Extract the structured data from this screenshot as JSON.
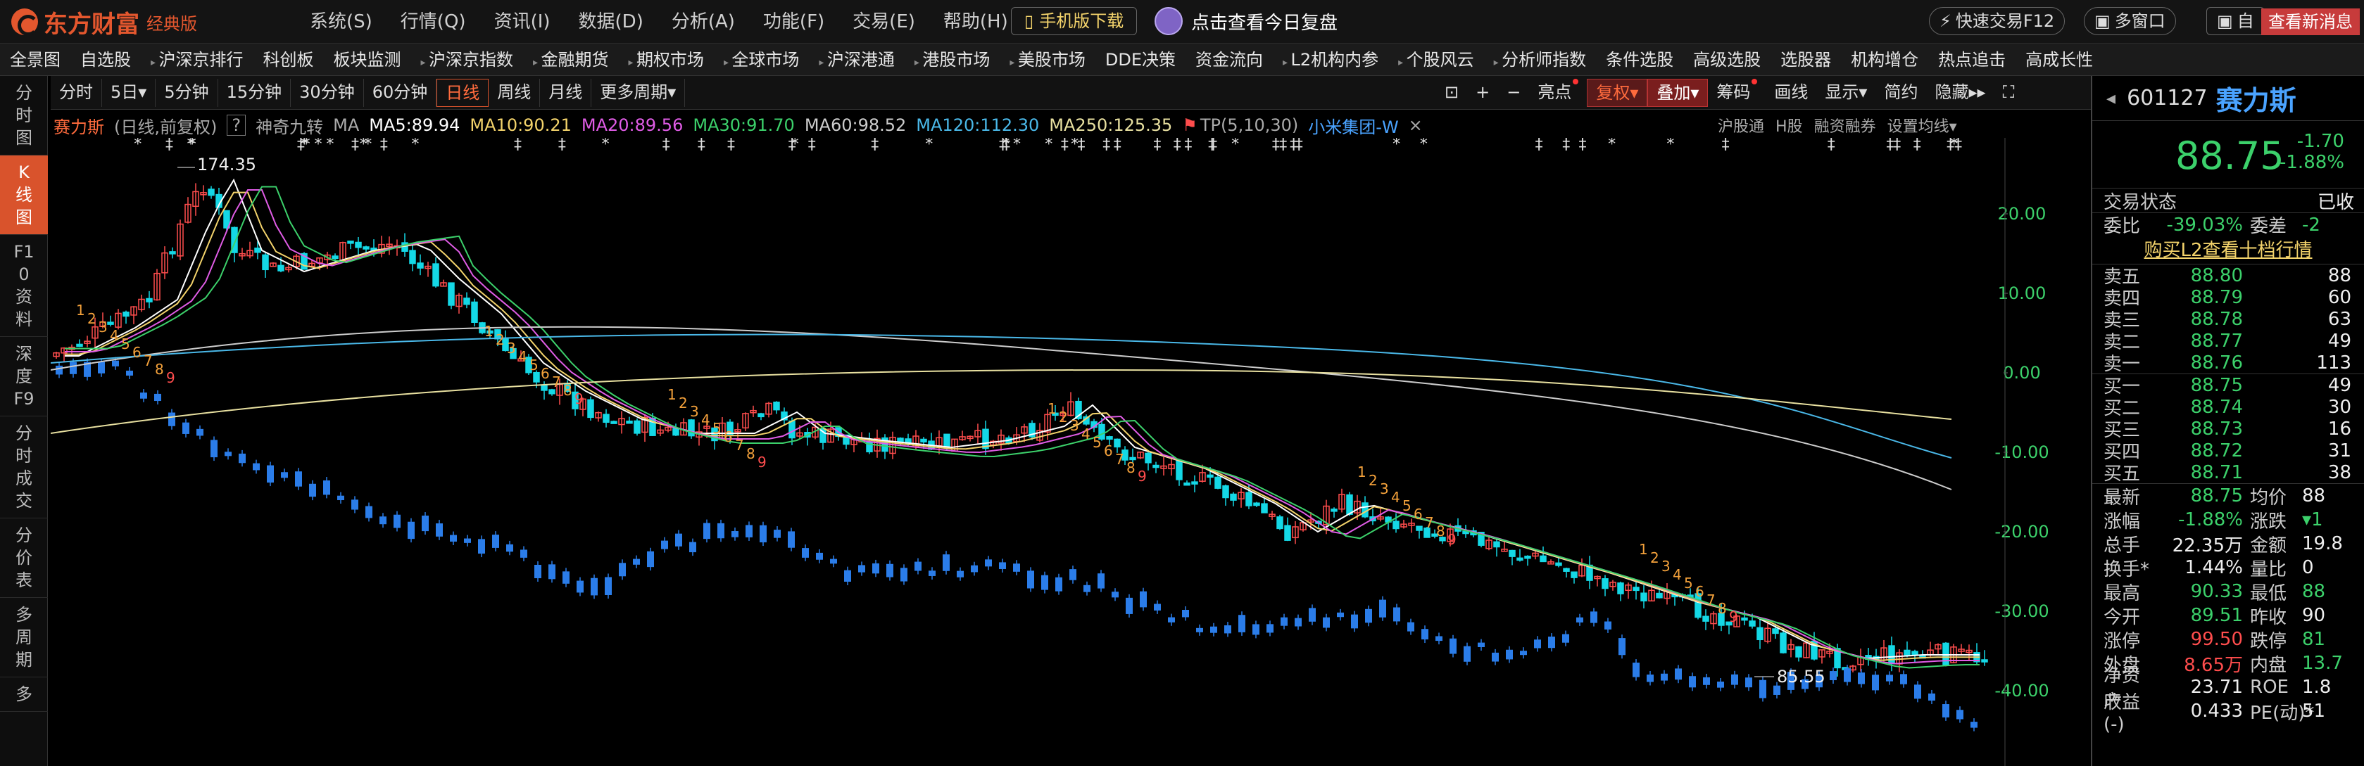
{
  "app": {
    "brand": "东方财富",
    "edition": "经典版",
    "menu": [
      "系统(S)",
      "行情(Q)",
      "资讯(I)",
      "数据(D)",
      "分析(A)",
      "功能(F)",
      "交易(E)",
      "帮助(H)"
    ],
    "mobile_download": "手机版下载",
    "daily_review": "点击查看今日复盘",
    "quick_trade": "快速交易F12",
    "multi_window": "多窗口",
    "cut": "自",
    "news": "查看新消息"
  },
  "nav": [
    "全景图",
    "自选股",
    "沪深京排行",
    "科创板",
    "板块监测",
    "沪深京指数",
    "金融期货",
    "期权市场",
    "全球市场",
    "沪深港通",
    "港股市场",
    "美股市场",
    "DDE决策",
    "资金流向",
    "L2机构内参",
    "个股风云",
    "分析师指数",
    "条件选股",
    "高级选股",
    "选股器",
    "机构增仓",
    "热点追击",
    "高成长性"
  ],
  "left_tabs": [
    {
      "label": "分时图",
      "active": false
    },
    {
      "label": "K线图",
      "active": true
    },
    {
      "label": "F10资料",
      "active": false
    },
    {
      "label": "深度F9",
      "active": false
    },
    {
      "label": "分时成交",
      "active": false
    },
    {
      "label": "分价表",
      "active": false
    },
    {
      "label": "多周期",
      "active": false
    },
    {
      "label": "多",
      "active": false
    }
  ],
  "periods": [
    {
      "label": "分时",
      "active": false
    },
    {
      "label": "5日▾",
      "active": false
    },
    {
      "label": "5分钟",
      "active": false
    },
    {
      "label": "15分钟",
      "active": false
    },
    {
      "label": "30分钟",
      "active": false
    },
    {
      "label": "60分钟",
      "active": false
    },
    {
      "label": "日线",
      "active": true
    },
    {
      "label": "周线",
      "active": false
    },
    {
      "label": "月线",
      "active": false
    },
    {
      "label": "更多周期▾",
      "active": false
    }
  ],
  "tools": {
    "plus": "+",
    "minus": "−",
    "highlight": "亮点",
    "adjust": "复权▾",
    "overlay": "叠加▾",
    "chips": "筹码",
    "draw": "画线",
    "display": "显示▾",
    "simple": "简约",
    "hide": "隐藏▸▸"
  },
  "legend": {
    "stock": "赛力斯",
    "mode": "(日线,前复权)",
    "q": "?",
    "magic": "神奇九转",
    "ma": "MA",
    "ma5": "MA5:89.94",
    "ma10": "MA10:90.21",
    "ma20": "MA20:89.56",
    "ma30": "MA30:91.70",
    "ma60": "MA60:98.52",
    "ma120": "MA120:112.30",
    "ma250": "MA250:125.35",
    "tp": "TP(5,10,30)",
    "compare": "小米集团-W",
    "close_x": "×",
    "right": [
      "沪股通",
      "H股",
      "融资融券",
      "设置均线▾"
    ]
  },
  "colors": {
    "ma5": "#ffffff",
    "ma10": "#f3d36b",
    "ma20": "#e05ce6",
    "ma30": "#3cd16b",
    "ma60": "#cccccc",
    "ma120": "#4ab8e8",
    "ma250": "#e8e0a0",
    "up": "#ff4d4d",
    "down": "#14d8e6",
    "compare": "#2b7de9"
  },
  "chart_data": {
    "type": "candlestick",
    "y_ticks": [
      "20.00",
      "10.00",
      "0.00",
      "-10.00",
      "-20.00",
      "-30.00",
      "-40.00"
    ],
    "high_label": "174.35",
    "low_label": "85.55"
  },
  "quote": {
    "code": "601127",
    "name": "赛力斯",
    "price": "88.75",
    "change": "-1.70",
    "change_pct": "-1.88%",
    "trade_status_label": "交易状态",
    "trade_status": "已收",
    "weibi_label": "委比",
    "weibi": "-39.03%",
    "weicha_label": "委差",
    "weicha": "-2",
    "l2_link": "购买L2查看十档行情",
    "asks": [
      {
        "label": "卖五",
        "price": "88.80",
        "vol": "88"
      },
      {
        "label": "卖四",
        "price": "88.79",
        "vol": "60"
      },
      {
        "label": "卖三",
        "price": "88.78",
        "vol": "63"
      },
      {
        "label": "卖二",
        "price": "88.77",
        "vol": "49"
      },
      {
        "label": "卖一",
        "price": "88.76",
        "vol": "113"
      }
    ],
    "bids": [
      {
        "label": "买一",
        "price": "88.75",
        "vol": "49"
      },
      {
        "label": "买二",
        "price": "88.74",
        "vol": "30"
      },
      {
        "label": "买三",
        "price": "88.73",
        "vol": "16"
      },
      {
        "label": "买四",
        "price": "88.72",
        "vol": "31"
      },
      {
        "label": "买五",
        "price": "88.71",
        "vol": "38"
      }
    ],
    "stats": [
      {
        "k": "最新",
        "v": "88.75",
        "vc": "green",
        "k2": "均价",
        "v2": "88",
        "v2c": "white"
      },
      {
        "k": "涨幅",
        "v": "-1.88%",
        "vc": "green",
        "k2": "涨跌",
        "v2": "▾1",
        "v2c": "green"
      },
      {
        "k": "总手",
        "v": "22.35万",
        "vc": "white",
        "k2": "金额",
        "v2": "19.8",
        "v2c": "white"
      },
      {
        "k": "换手*",
        "v": "1.44%",
        "vc": "white",
        "k2": "量比",
        "v2": "0",
        "v2c": "white"
      },
      {
        "k": "最高",
        "v": "90.33",
        "vc": "green",
        "k2": "最低",
        "v2": "88",
        "v2c": "green"
      },
      {
        "k": "今开",
        "v": "89.51",
        "vc": "green",
        "k2": "昨收",
        "v2": "90",
        "v2c": "white"
      },
      {
        "k": "涨停",
        "v": "99.50",
        "vc": "red",
        "k2": "跌停",
        "v2": "81",
        "v2c": "green"
      },
      {
        "k": "外盘",
        "v": "8.65万",
        "vc": "red",
        "k2": "内盘",
        "v2": "13.7",
        "v2c": "green"
      },
      {
        "k": "净资产",
        "v": "23.71",
        "vc": "white",
        "k2": "ROE",
        "v2": "1.8",
        "v2c": "white"
      },
      {
        "k": "收益(-)",
        "v": "0.433",
        "vc": "white",
        "k2": "PE(动)*",
        "v2": "51",
        "v2c": "white"
      }
    ]
  }
}
